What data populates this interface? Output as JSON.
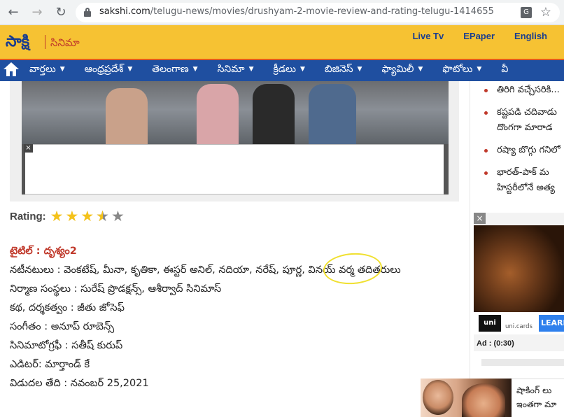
{
  "browser": {
    "url_host": "sakshi.com",
    "url_path": "/telugu-news/movies/drushyam-2-movie-review-and-rating-telugu-1414655"
  },
  "header": {
    "logo": "సాక్షి",
    "section": "సినిమా",
    "links": [
      "Live Tv",
      "EPaper",
      "English"
    ]
  },
  "menu": {
    "items": [
      "వార్తలు",
      "ఆంధ్రప్రదేశ్",
      "తెలంగాణ",
      "సినిమా",
      "క్రీడలు",
      "బిజినెస్",
      "ఫ్యామిలీ",
      "ఫొటోలు",
      "వీ"
    ]
  },
  "article": {
    "rating_label": "Rating:",
    "rating_value": 3.5,
    "rating_max": 5,
    "title_line": "టైటిల్‌ : దృశ్యం2",
    "details": [
      "నటీనటులు : వెంకటేష్‌, మీనా, కృతికా, ఈస్టర్‌ అనిల్‌, నదియా, నరేష్‌, పూర్ణ, వినయ్‌ వర్మ తదితరులు",
      "నిర్మాణ సంస్థలు : సురేష్‌ ప్రొడక్షన్స్‌, ఆశీర్వాద్‌ సినిమాస్‌",
      "కథ, దర్శకత్వం :  జీతు జోసెఫ్‌",
      "సంగీతం :  అనూప్‌ రూబెన్స్‌",
      "సినిమాటోగ్రఫీ : సతీష్‌ కురుప్‌",
      "ఎడిటర్‌: మార్తాండ్‌ కే",
      "విడుదల తేది : నవంబర్‌ 25,2021"
    ]
  },
  "sidebar": {
    "news": [
      [
        "తిరిగి వచ్చేసరికి..."
      ],
      [
        "కష్టపడి చదివాడు",
        "దొంగగా మారాడ"
      ],
      [
        "రష్యా బొగ్గు గనిలో"
      ],
      [
        "భారత్‌-పాక్‌ మ",
        "హిస్టరీలోనే అత్య"
      ]
    ],
    "ad": {
      "close": "×",
      "brand": "uni",
      "brand_site": "uni.cards",
      "cta": "LEARN",
      "time": "Ad : (0:30)"
    }
  },
  "popup": {
    "lines": [
      "షాకింగ్‌ లు",
      "ఇంతగా మా"
    ]
  }
}
